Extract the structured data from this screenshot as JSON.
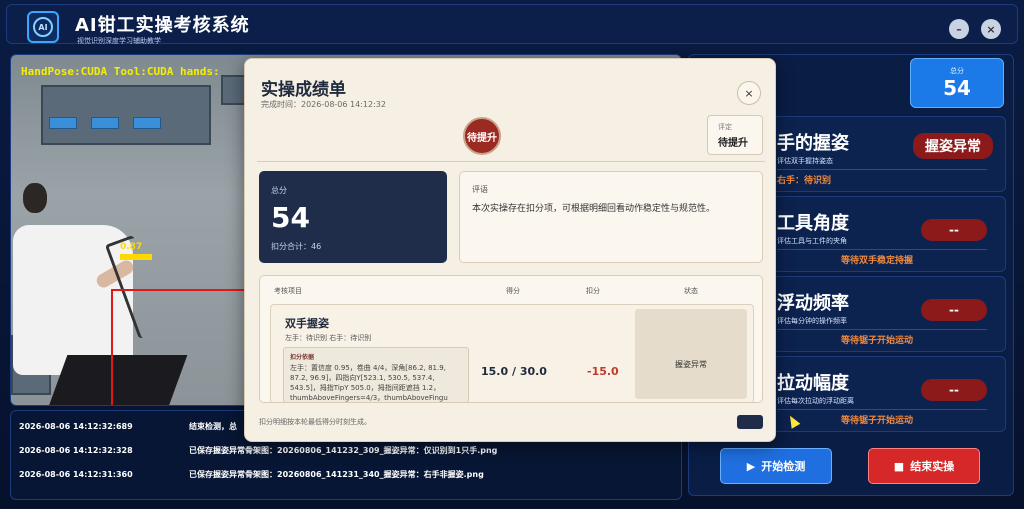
{
  "app": {
    "title": "AI钳工实操考核系统",
    "subtitle": "视觉识别深度学习辅助教学",
    "logo_text": "AI",
    "minimize_label": "–",
    "close_label": "×"
  },
  "video": {
    "hud": "HandPose:CUDA Tool:CUDA hands:",
    "detection_score": "0.87"
  },
  "logs": [
    {
      "time": "2026-08-06 14:12:32:689",
      "msg": "结束检测，总"
    },
    {
      "time": "2026-08-06 14:12:32:328",
      "msg": "已保存握姿异常骨架图：20260806_141232_309_握姿异常：仅识别到1只手.png"
    },
    {
      "time": "2026-08-06 14:12:31:360",
      "msg": "已保存握姿异常骨架图：20260806_141231_340_握姿异常：右手非握姿.png"
    }
  ],
  "score_card": {
    "label": "总分",
    "value": "54"
  },
  "metrics": [
    {
      "title": "手的握姿",
      "desc": "评估双手握持姿态",
      "status": "右手：待识别",
      "badge": "握姿异常"
    },
    {
      "title": "工具角度",
      "desc": "评估工具与工件的夹角",
      "status": "等待双手稳定持握",
      "badge": "--"
    },
    {
      "title": "浮动频率",
      "desc": "评估每分钟的操作频率",
      "status": "等待锯子开始运动",
      "badge": "--"
    },
    {
      "title": "拉动幅度",
      "desc": "评估每次拉动的浮动距离",
      "status": "等待锯子开始运动",
      "badge": "--"
    }
  ],
  "buttons": {
    "start": "开始检测",
    "stop": "结束实操"
  },
  "modal": {
    "title": "实操成绩单",
    "time": "完成时间：2026-08-06 14:12:32",
    "close": "×",
    "seal": "待提升",
    "rating_label": "评定",
    "rating_value": "待提升",
    "total_label": "总分",
    "total_value": "54",
    "deduct_total": "扣分合计：46",
    "comment_label": "评语",
    "comment_text": "本次实操存在扣分项，可根据明细回看动作稳定性与规范性。",
    "table_headers": {
      "item": "考核项目",
      "score": "得分",
      "deduct": "扣分",
      "status": "状态"
    },
    "row": {
      "name": "双手握姿",
      "hands": "左手：待识别    右手：待识别",
      "basis_title": "扣分依据",
      "basis_text": "左手：置信度 0.95，卷曲 4/4，深角[86.2, 81.9, 87.2, 96.9]，四指向Y[523.1, 530.5, 537.4, 543.5]，拇指TipY 505.0，拇指间距遮挡 1.2，thumbAboveFingers=4/3，thumbAboveFingu",
      "score": "15.0 / 30.0",
      "deduct": "-15.0",
      "status": "握姿异常"
    },
    "footer": "扣分明细按本轮最低得分时刻生成。"
  }
}
